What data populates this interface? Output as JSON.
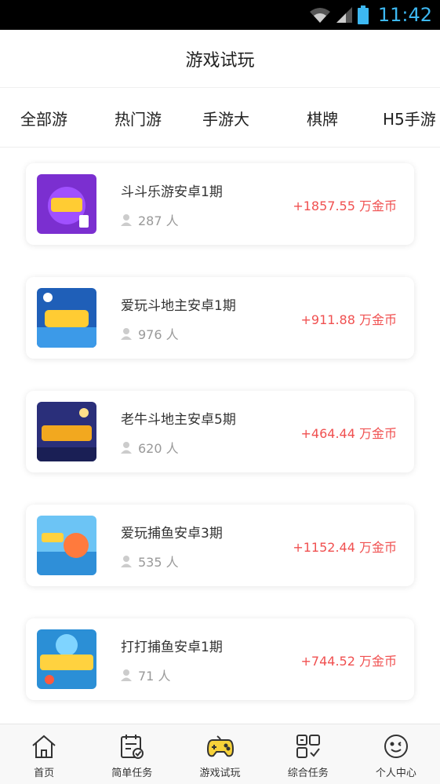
{
  "status_bar": {
    "time": "11:42"
  },
  "header": {
    "title": "游戏试玩"
  },
  "tabs": [
    {
      "label": "全部游"
    },
    {
      "label": "热门游"
    },
    {
      "label": "手游大"
    },
    {
      "label": "棋牌"
    },
    {
      "label": "H5手游"
    }
  ],
  "games": [
    {
      "name": "斗斗乐游安卓1期",
      "players": "287 人",
      "reward": "+1857.55 万金币",
      "thumb_color": "#7b2fd0"
    },
    {
      "name": "爱玩斗地主安卓1期",
      "players": "976 人",
      "reward": "+911.88 万金币",
      "thumb_color": "#1f5fb8"
    },
    {
      "name": "老牛斗地主安卓5期",
      "players": "620 人",
      "reward": "+464.44 万金币",
      "thumb_color": "#2a2f7a"
    },
    {
      "name": "爱玩捕鱼安卓3期",
      "players": "535 人",
      "reward": "+1152.44 万金币",
      "thumb_color": "#4aa8e8"
    },
    {
      "name": "打打捕鱼安卓1期",
      "players": "71 人",
      "reward": "+744.52 万金币",
      "thumb_color": "#2b8fd6"
    }
  ],
  "bottom_nav": [
    {
      "label": "首页",
      "icon": "home-icon"
    },
    {
      "label": "简单任务",
      "icon": "calendar-check-icon"
    },
    {
      "label": "游戏试玩",
      "icon": "gamepad-icon"
    },
    {
      "label": "综合任务",
      "icon": "grid-check-icon"
    },
    {
      "label": "个人中心",
      "icon": "smiley-icon"
    }
  ]
}
